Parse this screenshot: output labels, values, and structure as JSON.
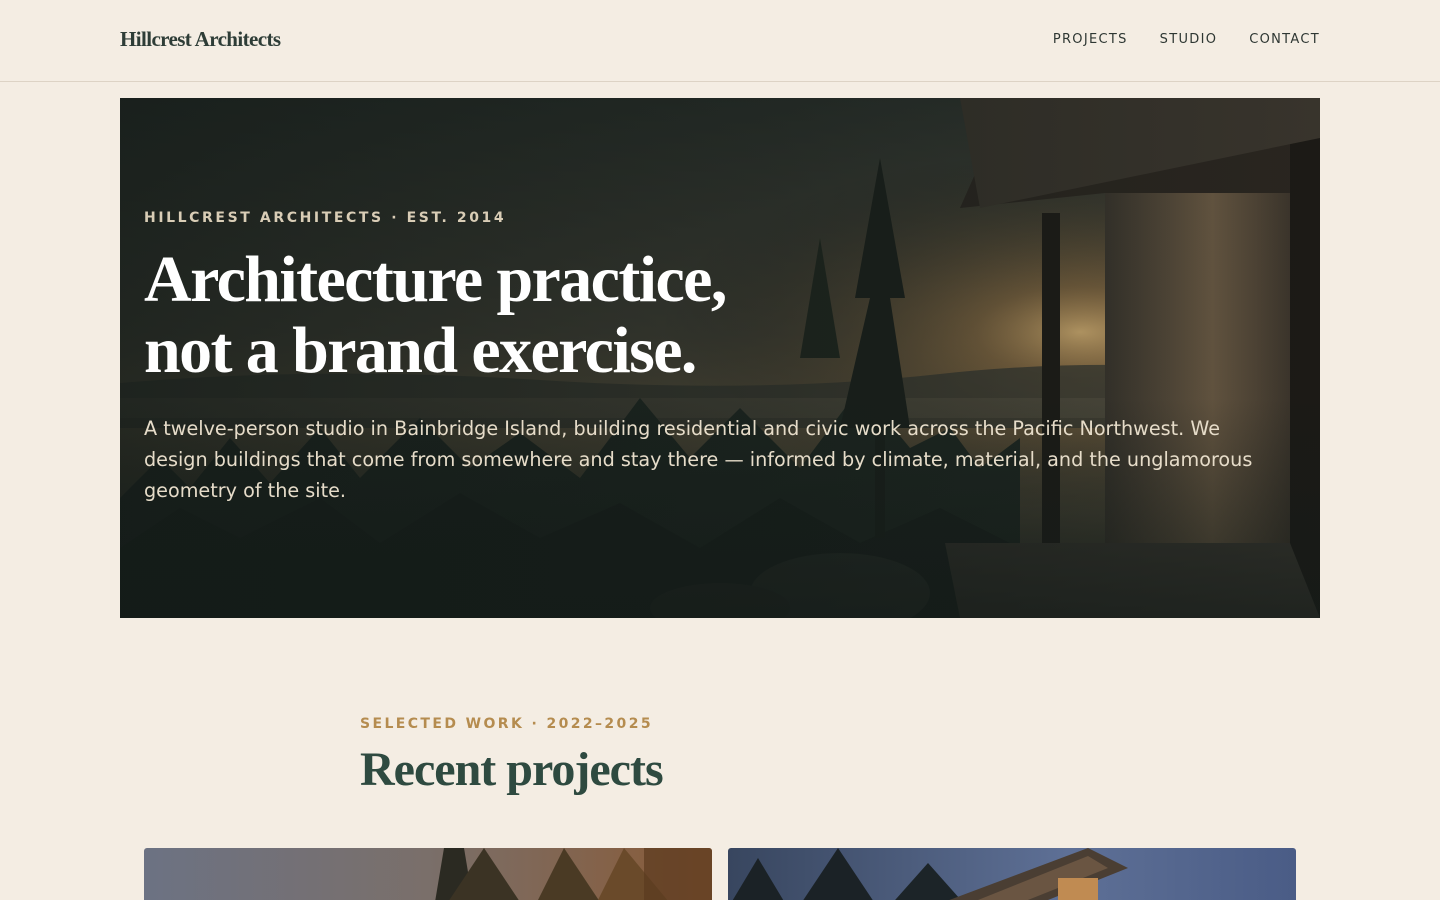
{
  "header": {
    "logo": "Hillcrest Architects",
    "nav": [
      {
        "label": "PROJECTS"
      },
      {
        "label": "STUDIO"
      },
      {
        "label": "CONTACT"
      }
    ]
  },
  "hero": {
    "eyebrow": "HILLCREST ARCHITECTS · EST. 2014",
    "title_line1": "Architecture practice,",
    "title_line2": "not a brand exercise.",
    "description": "A twelve-person studio in Bainbridge Island, building residential and civic work across the Pacific Northwest. We design buildings that come from somewhere and stay there — informed by climate, material, and the unglamorous geometry of the site."
  },
  "work": {
    "eyebrow": "SELECTED WORK · 2022–2025",
    "title": "Recent projects"
  },
  "colors": {
    "background": "#f4ede3",
    "accent": "#b58c4f",
    "heading": "#2e4a40",
    "text": "#2e3733"
  }
}
